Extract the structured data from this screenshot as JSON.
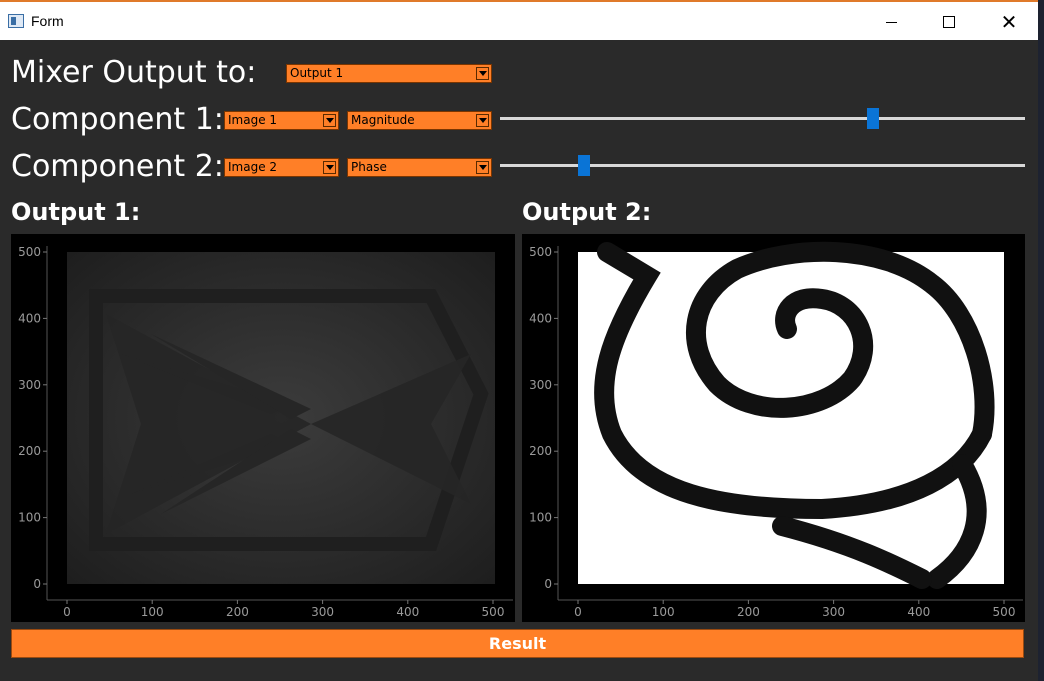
{
  "window": {
    "title": "Form"
  },
  "mixer": {
    "label": "Mixer Output to:",
    "output_select": "Output 1"
  },
  "component1": {
    "label": "Component 1:",
    "image_select": "Image 1",
    "mode_select": "Magnitude",
    "slider_value": 0.71
  },
  "component2": {
    "label": "Component 2:",
    "image_select": "Image 2",
    "mode_select": "Phase",
    "slider_value": 0.16
  },
  "outputs": [
    {
      "title": "Output 1:",
      "x_ticks": [
        "0",
        "100",
        "200",
        "300",
        "400",
        "500"
      ],
      "y_ticks": [
        "500",
        "400",
        "300",
        "200",
        "100",
        "0"
      ]
    },
    {
      "title": "Output 2:",
      "x_ticks": [
        "0",
        "100",
        "200",
        "300",
        "400",
        "500"
      ],
      "y_ticks": [
        "500",
        "400",
        "300",
        "200",
        "100",
        "0"
      ]
    }
  ],
  "result_button": "Result",
  "colors": {
    "accent": "#ff7f27",
    "background": "#2a2a2a",
    "slider_handle": "#0a74d6"
  }
}
